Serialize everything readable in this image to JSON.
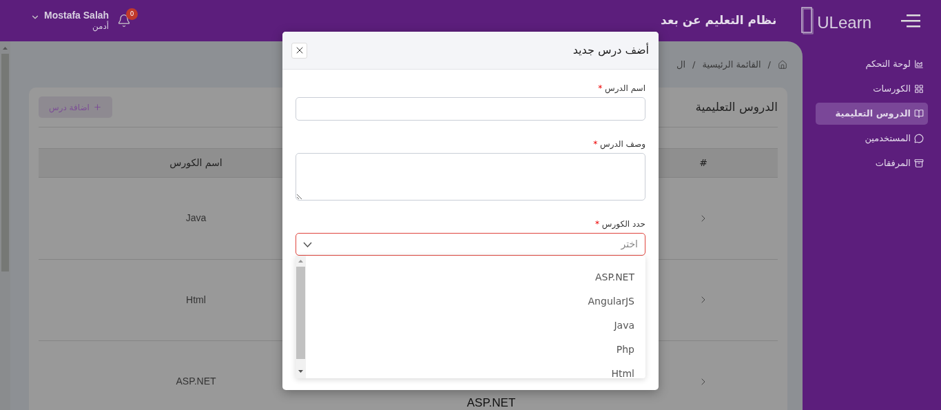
{
  "header": {
    "logo": "ULearn",
    "title": "نظام التعليم عن بعد",
    "notifications": "0",
    "user": {
      "name": "Mostafa Salah",
      "role": "أدمن"
    }
  },
  "sidebar": {
    "items": [
      {
        "label": "لوحة التحكم",
        "selected": false
      },
      {
        "label": "الكورسات",
        "selected": false
      },
      {
        "label": "الدروس التعليمية",
        "selected": true
      },
      {
        "label": "المستخدمين",
        "selected": false
      },
      {
        "label": "المرفقات",
        "selected": false
      }
    ]
  },
  "breadcrumb": {
    "separator": "/",
    "items": [
      "القائمة الرئيسية",
      "ال"
    ]
  },
  "card": {
    "title": "الدروس التعليمية",
    "add_button": "اضافة درس",
    "table": {
      "columns": [
        "#",
        "اسم الكورس"
      ],
      "rows": [
        {
          "course": "Java"
        },
        {
          "course": "Html"
        },
        {
          "course": "ASP.NET",
          "column_2": "ASP.NET"
        }
      ]
    }
  },
  "modal": {
    "title": "أضف درس جديد",
    "fields": [
      {
        "kind": "text",
        "label": "اسم الدرس",
        "required_mark": "*"
      },
      {
        "kind": "textarea",
        "label": "وصف الدرس",
        "required_mark": "*"
      },
      {
        "kind": "select",
        "label": "حدد الكورس",
        "required_mark": "*",
        "placeholder": "اختر",
        "invalid": true,
        "expanded": true,
        "options": [
          "ASP.NET",
          "AngularJS",
          "Java",
          "Php",
          "Html"
        ]
      }
    ]
  }
}
